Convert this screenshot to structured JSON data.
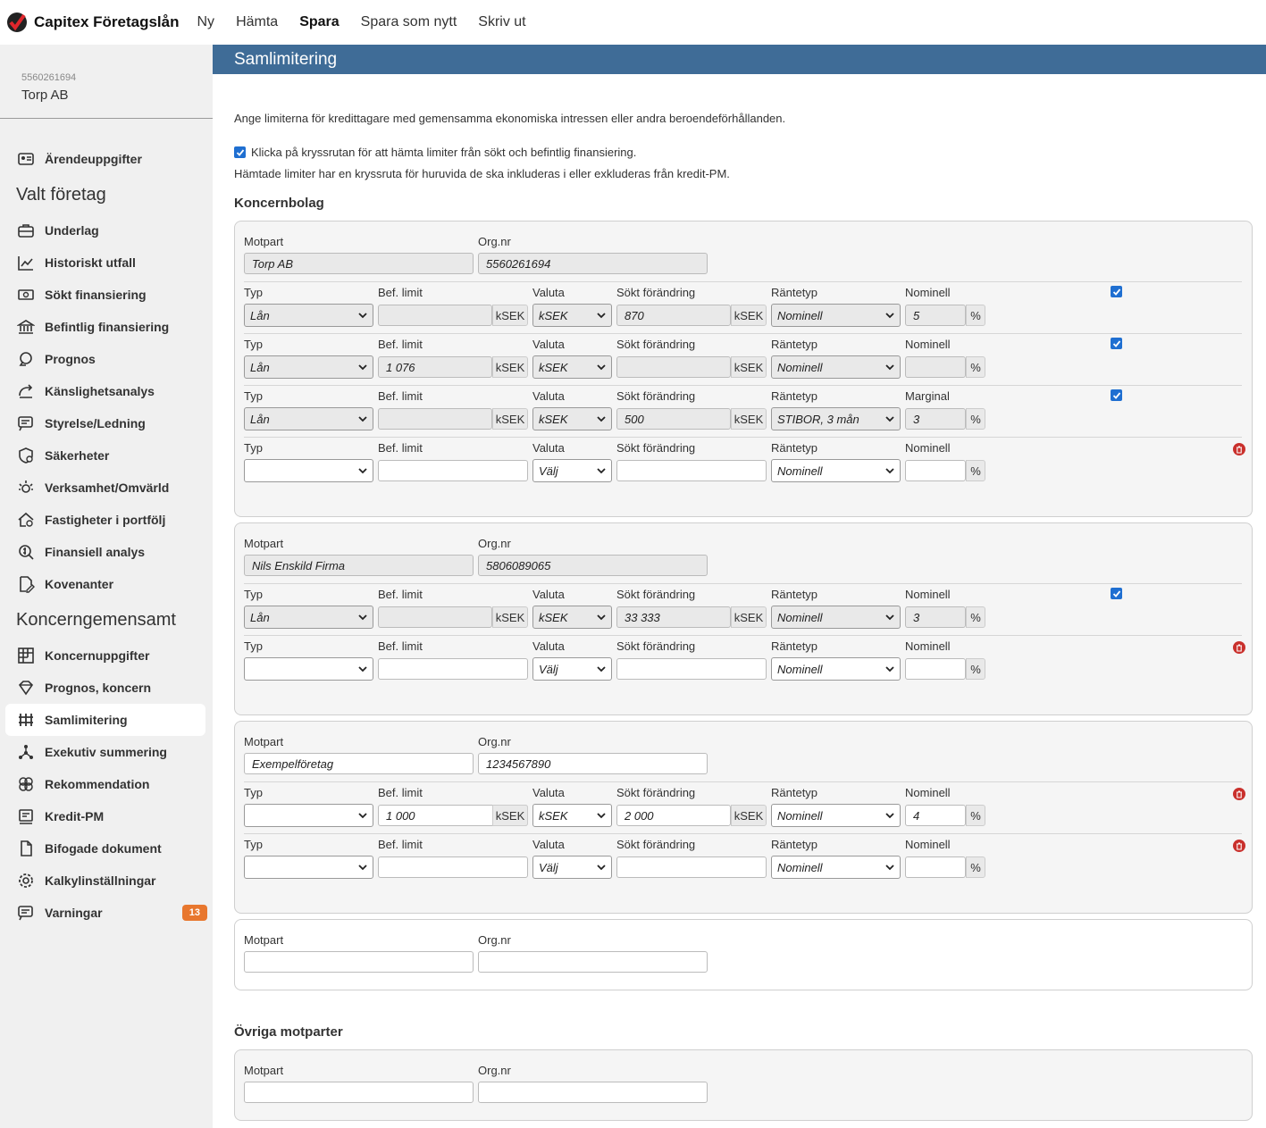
{
  "app": {
    "brand": "Capitex Företagslån",
    "nav": [
      "Ny",
      "Hämta",
      "Spara",
      "Spara som nytt",
      "Skriv ut"
    ],
    "active_nav": "Spara"
  },
  "company": {
    "orgnr": "5560261694",
    "name": "Torp AB"
  },
  "sidebar": {
    "top_item": "Ärendeuppgifter",
    "heading_valt": "Valt företag",
    "valt_items": [
      "Underlag",
      "Historiskt utfall",
      "Sökt finansiering",
      "Befintlig finansiering",
      "Prognos",
      "Känslighetsanalys",
      "Styrelse/Ledning",
      "Säkerheter",
      "Verksamhet/Omvärld",
      "Fastigheter i portfölj",
      "Finansiell analys",
      "Kovenanter"
    ],
    "heading_koncern": "Koncerngemensamt",
    "koncern_items": [
      "Koncernuppgifter",
      "Prognos, koncern",
      "Samlimitering",
      "Exekutiv summering",
      "Rekommendation",
      "Kredit-PM",
      "Bifogade dokument",
      "Kalkylinställningar",
      "Varningar"
    ],
    "active": "Samlimitering",
    "warnings_count": "13"
  },
  "page": {
    "title": "Samlimitering",
    "intro": "Ange limiterna för kredittagare med gemensamma ekonomiska intressen eller andra beroendeförhållanden.",
    "checkbox_text": "Klicka på kryssrutan för att hämta limiter från sökt och befintlig finansiering.",
    "info2": "Hämtade limiter har en kryssruta för huruvida de ska inkluderas i eller exkluderas från kredit-PM.",
    "section_koncern": "Koncernbolag",
    "section_ovriga": "Övriga motparter"
  },
  "labels": {
    "motpart": "Motpart",
    "orgnr": "Org.nr",
    "typ": "Typ",
    "bef_limit": "Bef. limit",
    "valuta": "Valuta",
    "sokt": "Sökt förändring",
    "rantetyp": "Räntetyp",
    "unit": "kSEK",
    "percent": "%"
  },
  "cards": [
    {
      "motpart": "Torp AB",
      "orgnr": "5560261694",
      "readonly": true,
      "rows": [
        {
          "typ": "Lån",
          "bef": "",
          "valuta": "kSEK",
          "sokt": "870",
          "rantetyp": "Nominell",
          "ratelabel": "Nominell",
          "rate": "5",
          "checked": true,
          "readonly": true
        },
        {
          "typ": "Lån",
          "bef": "1 076",
          "valuta": "kSEK",
          "sokt": "",
          "rantetyp": "Nominell",
          "ratelabel": "Nominell",
          "rate": "",
          "checked": true,
          "readonly": true
        },
        {
          "typ": "Lån",
          "bef": "",
          "valuta": "kSEK",
          "sokt": "500",
          "rantetyp": "STIBOR, 3 mån",
          "ratelabel": "Marginal",
          "rate": "3",
          "checked": true,
          "readonly": true
        },
        {
          "typ": "",
          "bef": "",
          "valuta": "Välj",
          "sokt": "",
          "rantetyp": "Nominell",
          "ratelabel": "Nominell",
          "rate": "",
          "checked": false,
          "readonly": false
        }
      ]
    },
    {
      "motpart": "Nils Enskild Firma",
      "orgnr": "5806089065",
      "readonly": true,
      "rows": [
        {
          "typ": "Lån",
          "bef": "",
          "valuta": "kSEK",
          "sokt": "33 333",
          "rantetyp": "Nominell",
          "ratelabel": "Nominell",
          "rate": "3",
          "checked": true,
          "readonly": true
        },
        {
          "typ": "",
          "bef": "",
          "valuta": "Välj",
          "sokt": "",
          "rantetyp": "Nominell",
          "ratelabel": "Nominell",
          "rate": "",
          "checked": false,
          "readonly": false
        }
      ]
    },
    {
      "motpart": "Exempelföretag",
      "orgnr": "1234567890",
      "readonly": false,
      "rows": [
        {
          "typ": "",
          "bef": "1 000",
          "valuta": "kSEK",
          "sokt": "2 000",
          "rantetyp": "Nominell",
          "ratelabel": "Nominell",
          "rate": "4",
          "checked": false,
          "readonly": false
        },
        {
          "typ": "",
          "bef": "",
          "valuta": "Välj",
          "sokt": "",
          "rantetyp": "Nominell",
          "ratelabel": "Nominell",
          "rate": "",
          "checked": false,
          "readonly": false
        }
      ]
    },
    {
      "motpart": "",
      "orgnr": "",
      "readonly": false,
      "rows": []
    }
  ],
  "ovriga": [
    {
      "motpart": "",
      "orgnr": ""
    }
  ],
  "colors": {
    "header": "#3f6c97",
    "accent": "#1f6fd1",
    "badge": "#e8772e",
    "delete": "#c9302c"
  },
  "icons": [
    "profile-card-icon",
    "briefcase-icon",
    "chart-icon",
    "money-icon",
    "bank-icon",
    "bulb-icon",
    "arrow-curve-icon",
    "board-icon",
    "shield-icon",
    "sun-icon",
    "house-icon",
    "dollar-search-icon",
    "edit-doc-icon",
    "grid-icon",
    "diamond-icon",
    "samlimit-icon",
    "network-icon",
    "brain-icon",
    "pm-doc-icon",
    "document-icon",
    "gear-icon",
    "warning-chat-icon"
  ]
}
